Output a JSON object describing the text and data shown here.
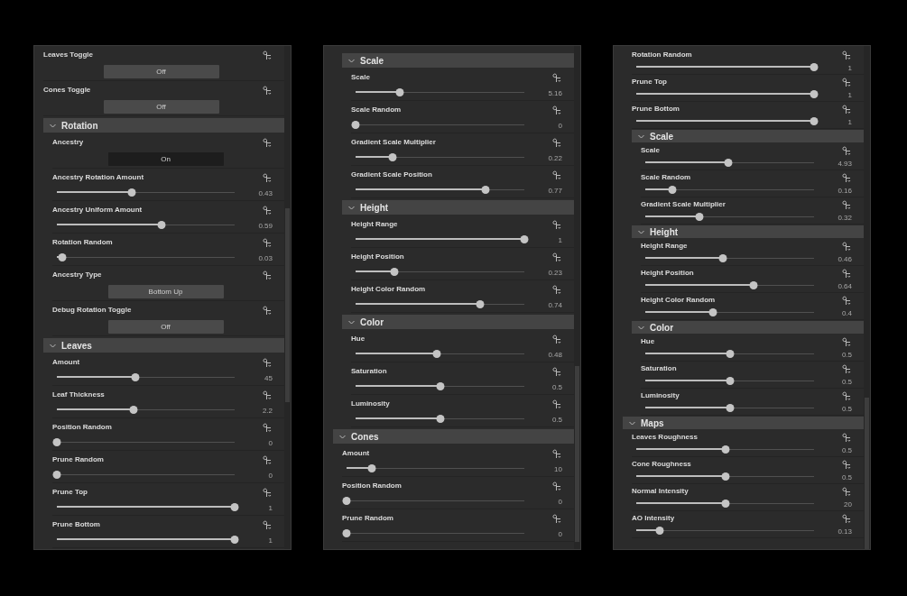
{
  "panels": [
    {
      "items": [
        {
          "kind": "toggle",
          "label": "Leaves Toggle",
          "value": "Off",
          "on": false
        },
        {
          "kind": "toggle",
          "label": "Cones Toggle",
          "value": "Off",
          "on": false
        },
        {
          "kind": "section",
          "title": "Rotation",
          "expanded": true,
          "children": [
            {
              "kind": "toggle",
              "label": "Ancestry",
              "value": "On",
              "on": true
            },
            {
              "kind": "slider",
              "label": "Ancestry Rotation Amount",
              "level": 0.42,
              "reading": "0.43"
            },
            {
              "kind": "slider",
              "label": "Ancestry Uniform Amount",
              "level": 0.59,
              "reading": "0.59"
            },
            {
              "kind": "slider",
              "label": "Rotation Random",
              "level": 0.03,
              "reading": "0.03"
            },
            {
              "kind": "select",
              "label": "Ancestry Type",
              "value": "Bottom Up"
            },
            {
              "kind": "toggle",
              "label": "Debug Rotation Toggle",
              "value": "Off",
              "on": false
            }
          ]
        },
        {
          "kind": "section",
          "title": "Leaves",
          "expanded": true,
          "children": [
            {
              "kind": "slider",
              "label": "Amount",
              "level": 0.44,
              "reading": "45"
            },
            {
              "kind": "slider",
              "label": "Leaf Thickness",
              "level": 0.43,
              "reading": "2.2"
            },
            {
              "kind": "slider",
              "label": "Position Random",
              "level": 0,
              "reading": "0"
            },
            {
              "kind": "slider",
              "label": "Prune Random",
              "level": 0,
              "reading": "0"
            },
            {
              "kind": "slider",
              "label": "Prune Top",
              "level": 1,
              "reading": "1"
            },
            {
              "kind": "slider",
              "label": "Prune Bottom",
              "level": 1,
              "reading": "1"
            }
          ]
        }
      ]
    },
    {
      "items": [
        {
          "kind": "group",
          "children": [
            {
              "kind": "section",
              "title": "Scale",
              "expanded": true,
              "children": [
                {
                  "kind": "slider",
                  "label": "Scale",
                  "level": 0.26,
                  "reading": "5.16"
                },
                {
                  "kind": "slider",
                  "label": "Scale Random",
                  "level": 0,
                  "reading": "0"
                },
                {
                  "kind": "slider",
                  "label": "Gradient Scale Multiplier",
                  "level": 0.22,
                  "reading": "0.22"
                },
                {
                  "kind": "slider",
                  "label": "Gradient Scale Position",
                  "level": 0.77,
                  "reading": "0.77"
                }
              ]
            },
            {
              "kind": "section",
              "title": "Height",
              "expanded": true,
              "children": [
                {
                  "kind": "slider",
                  "label": "Height Range",
                  "level": 1,
                  "reading": "1"
                },
                {
                  "kind": "slider",
                  "label": "Height Position",
                  "level": 0.23,
                  "reading": "0.23"
                },
                {
                  "kind": "slider",
                  "label": "Height Color Random",
                  "level": 0.74,
                  "reading": "0.74"
                }
              ]
            },
            {
              "kind": "section",
              "title": "Color",
              "expanded": true,
              "children": [
                {
                  "kind": "slider",
                  "label": "Hue",
                  "level": 0.48,
                  "reading": "0.48"
                },
                {
                  "kind": "slider",
                  "label": "Saturation",
                  "level": 0.5,
                  "reading": "0.5"
                },
                {
                  "kind": "slider",
                  "label": "Luminosity",
                  "level": 0.5,
                  "reading": "0.5"
                }
              ]
            }
          ]
        },
        {
          "kind": "section",
          "title": "Cones",
          "expanded": true,
          "children": [
            {
              "kind": "slider",
              "label": "Amount",
              "level": 0.14,
              "reading": "10"
            },
            {
              "kind": "slider",
              "label": "Position Random",
              "level": 0,
              "reading": "0"
            },
            {
              "kind": "slider",
              "label": "Prune Random",
              "level": 0,
              "reading": "0"
            }
          ]
        }
      ]
    },
    {
      "items": [
        {
          "kind": "group",
          "children": [
            {
              "kind": "slider",
              "label": "Rotation Random",
              "level": 1,
              "reading": "1"
            },
            {
              "kind": "slider",
              "label": "Prune Top",
              "level": 1,
              "reading": "1"
            },
            {
              "kind": "slider",
              "label": "Prune Bottom",
              "level": 1,
              "reading": "1"
            },
            {
              "kind": "section",
              "title": "Scale",
              "expanded": true,
              "children": [
                {
                  "kind": "slider",
                  "label": "Scale",
                  "level": 0.49,
                  "reading": "4.93"
                },
                {
                  "kind": "slider",
                  "label": "Scale Random",
                  "level": 0.16,
                  "reading": "0.16"
                },
                {
                  "kind": "slider",
                  "label": "Gradient Scale Multiplier",
                  "level": 0.32,
                  "reading": "0.32"
                }
              ]
            },
            {
              "kind": "section",
              "title": "Height",
              "expanded": true,
              "children": [
                {
                  "kind": "slider",
                  "label": "Height Range",
                  "level": 0.46,
                  "reading": "0.46"
                },
                {
                  "kind": "slider",
                  "label": "Height Position",
                  "level": 0.64,
                  "reading": "0.64"
                },
                {
                  "kind": "slider",
                  "label": "Height Color Random",
                  "level": 0.4,
                  "reading": "0.4"
                }
              ]
            },
            {
              "kind": "section",
              "title": "Color",
              "expanded": true,
              "children": [
                {
                  "kind": "slider",
                  "label": "Hue",
                  "level": 0.5,
                  "reading": "0.5"
                },
                {
                  "kind": "slider",
                  "label": "Saturation",
                  "level": 0.5,
                  "reading": "0.5"
                },
                {
                  "kind": "slider",
                  "label": "Luminosity",
                  "level": 0.5,
                  "reading": "0.5"
                }
              ]
            }
          ]
        },
        {
          "kind": "section",
          "title": "Maps",
          "expanded": true,
          "children": [
            {
              "kind": "slider",
              "label": "Leaves Roughness",
              "level": 0.5,
              "reading": "0.5"
            },
            {
              "kind": "slider",
              "label": "Cone Roughness",
              "level": 0.5,
              "reading": "0.5"
            },
            {
              "kind": "slider",
              "label": "Normal Intensity",
              "level": 0.5,
              "reading": "20"
            },
            {
              "kind": "slider",
              "label": "AO Intensity",
              "level": 0.13,
              "reading": "0.13"
            }
          ]
        }
      ]
    }
  ]
}
